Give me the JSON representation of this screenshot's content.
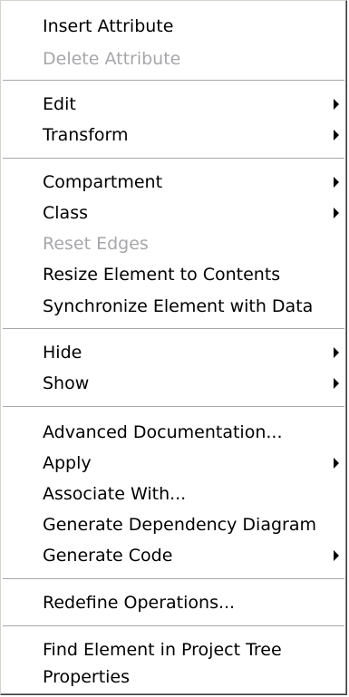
{
  "menu": {
    "items": [
      {
        "label": "Insert Attribute"
      },
      {
        "label": "Delete Attribute"
      },
      {
        "label": "Edit"
      },
      {
        "label": "Transform"
      },
      {
        "label": "Compartment"
      },
      {
        "label": "Class"
      },
      {
        "label": "Reset Edges"
      },
      {
        "label": "Resize Element to Contents"
      },
      {
        "label": "Synchronize Element with Data"
      },
      {
        "label": "Hide"
      },
      {
        "label": "Show"
      },
      {
        "label": "Advanced Documentation..."
      },
      {
        "label": "Apply"
      },
      {
        "label": "Associate With..."
      },
      {
        "label": "Generate Dependency Diagram"
      },
      {
        "label": "Generate Code"
      },
      {
        "label": "Redefine Operations..."
      },
      {
        "label": "Find Element in Project Tree"
      },
      {
        "label": "Properties"
      }
    ]
  }
}
